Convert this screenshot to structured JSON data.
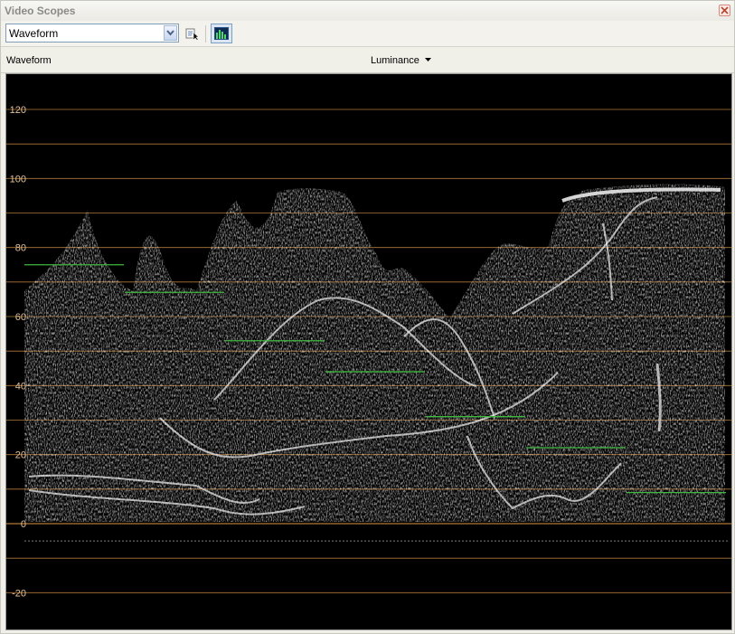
{
  "window": {
    "title": "Video Scopes"
  },
  "toolbar": {
    "scope_select_value": "Waveform"
  },
  "header": {
    "scope_label": "Waveform",
    "mode_label": "Luminance"
  },
  "scope": {
    "gridlines": [
      120,
      110,
      100,
      90,
      80,
      70,
      60,
      50,
      40,
      30,
      20,
      10,
      0,
      -10,
      -20
    ],
    "labeled_ticks": [
      120,
      100,
      80,
      60,
      40,
      20,
      0,
      -20
    ],
    "grid_color": "#b07838",
    "label_color": "#e0c09a",
    "marker_color": "#3fb83f",
    "range": [
      -25,
      130
    ]
  }
}
